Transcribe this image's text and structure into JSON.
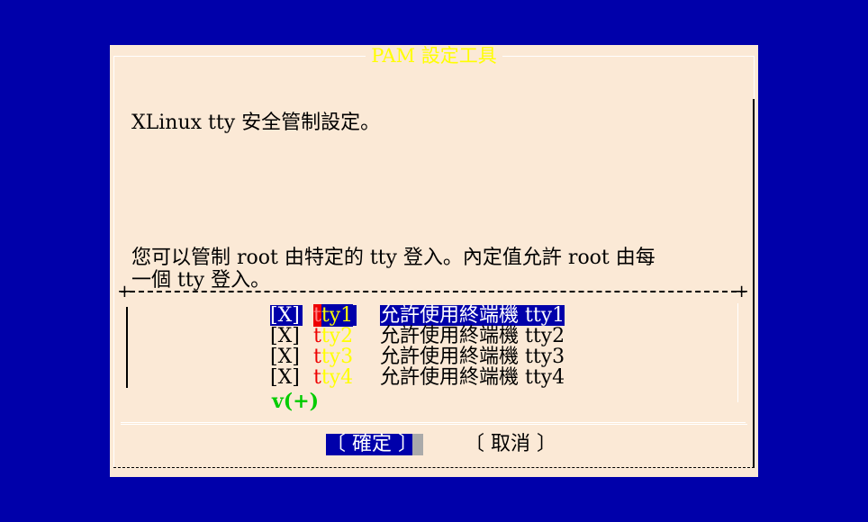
{
  "dialog": {
    "title": "PAM 設定工具",
    "body_line1": "XLinux tty 安全管制設定。",
    "body_line2": "您可以管制 root 由特定的 tty 登入。內定值允許 root 由每\n一個 tty 登入。"
  },
  "list": {
    "items": [
      {
        "check": "[X]",
        "tag_hot": "t",
        "tag_rest": "ty1",
        "desc": "允許使用終端機 tty1",
        "selected": true
      },
      {
        "check": "[X]",
        "tag_hot": "t",
        "tag_rest": "ty2",
        "desc": "允許使用終端機 tty2",
        "selected": false
      },
      {
        "check": "[X]",
        "tag_hot": "t",
        "tag_rest": "ty3",
        "desc": "允許使用終端機 tty3",
        "selected": false
      },
      {
        "check": "[X]",
        "tag_hot": "t",
        "tag_rest": "ty4",
        "desc": "允許使用終端機 tty4",
        "selected": false
      }
    ],
    "more_indicator": "v(+)"
  },
  "buttons": {
    "ok_label": "〔 確定 〕",
    "cancel_label": "〔 取消 〕"
  },
  "colors": {
    "background": "#0000aa",
    "dialog_bg": "#fbe9d6",
    "title": "#ffff00",
    "hotkey": "#ee0000",
    "more": "#00cc00"
  }
}
